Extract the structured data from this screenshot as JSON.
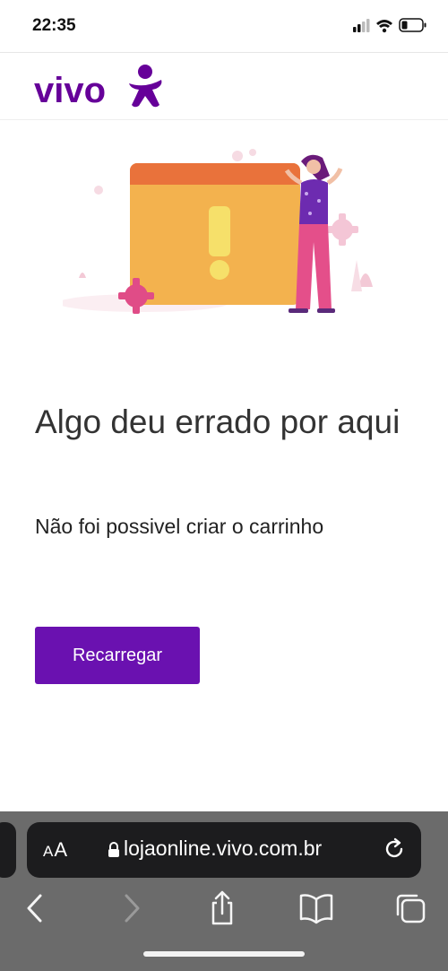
{
  "status_bar": {
    "time": "22:35"
  },
  "header": {
    "logo_text": "vivo",
    "brand_color": "#660099"
  },
  "error": {
    "title": "Algo deu errado por aqui",
    "message": "Não foi possivel criar o carrinho"
  },
  "actions": {
    "reload_label": "Recarregar",
    "button_color": "#6a11b0"
  },
  "browser": {
    "text_size_label_small": "A",
    "text_size_label_large": "A",
    "url": "lojaonline.vivo.com.br"
  }
}
